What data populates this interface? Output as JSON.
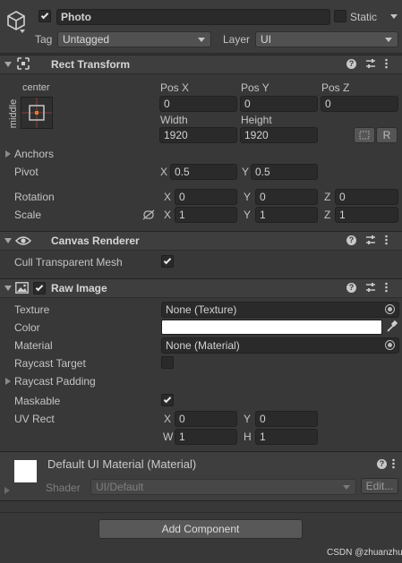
{
  "gameobject": {
    "name": "Photo",
    "active": true,
    "static_label": "Static",
    "static_checked": false,
    "tag_label": "Tag",
    "tag_value": "Untagged",
    "layer_label": "Layer",
    "layer_value": "UI"
  },
  "rect_transform": {
    "title": "Rect Transform",
    "anchor_h": "center",
    "anchor_v": "middle",
    "pos_x_label": "Pos X",
    "pos_x": "0",
    "pos_y_label": "Pos Y",
    "pos_y": "0",
    "pos_z_label": "Pos Z",
    "pos_z": "0",
    "width_label": "Width",
    "width": "1920",
    "height_label": "Height",
    "height": "1920",
    "r_button": "R",
    "anchors_label": "Anchors",
    "pivot_label": "Pivot",
    "pivot_x": "0.5",
    "pivot_y": "0.5",
    "rotation_label": "Rotation",
    "rot_x": "0",
    "rot_y": "0",
    "rot_z": "0",
    "scale_label": "Scale",
    "scale_x": "1",
    "scale_y": "1",
    "scale_z": "1",
    "x": "X",
    "y": "Y",
    "z": "Z"
  },
  "canvas_renderer": {
    "title": "Canvas Renderer",
    "cull_label": "Cull Transparent Mesh",
    "cull_checked": true
  },
  "raw_image": {
    "title": "Raw Image",
    "enabled": true,
    "texture_label": "Texture",
    "texture_value": "None (Texture)",
    "color_label": "Color",
    "color_value": "#ffffff",
    "material_label": "Material",
    "material_value": "None (Material)",
    "raycast_target_label": "Raycast Target",
    "raycast_target_checked": false,
    "raycast_padding_label": "Raycast Padding",
    "maskable_label": "Maskable",
    "maskable_checked": true,
    "uvrect_label": "UV Rect",
    "x_label": "X",
    "uv_x": "0",
    "y_label": "Y",
    "uv_y": "0",
    "w_label": "W",
    "uv_w": "1",
    "h_label": "H",
    "uv_h": "1"
  },
  "material_preview": {
    "title": "Default UI Material (Material)",
    "shader_label": "Shader",
    "shader_value": "UI/Default",
    "edit_label": "Edit..."
  },
  "footer": {
    "add_component": "Add Component",
    "watermark": "CSDN @zhuanzhuo"
  }
}
